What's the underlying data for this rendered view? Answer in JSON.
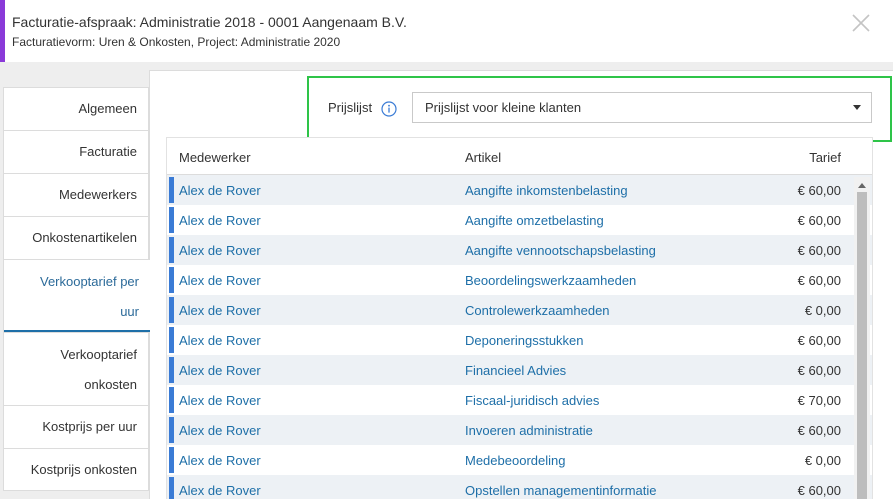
{
  "header": {
    "title": "Facturatie-afspraak: Administratie 2018 - 0001 Aangenaam B.V.",
    "subtitle": "Facturatievorm: Uren & Onkosten, Project: Administratie 2020",
    "accent_color": "#8a3ad8"
  },
  "tabs": [
    {
      "label": "Algemeen",
      "active": false
    },
    {
      "label": "Facturatie",
      "active": false
    },
    {
      "label": "Medewerkers",
      "active": false
    },
    {
      "label": "Onkostenartikelen",
      "active": false
    },
    {
      "label_lines": [
        "Verkooptarief per",
        "uur"
      ],
      "active": true
    },
    {
      "label_lines": [
        "Verkooptarief",
        "onkosten"
      ],
      "active": false
    },
    {
      "label": "Kostprijs per uur",
      "active": false
    },
    {
      "label": "Kostprijs onkosten",
      "active": false
    }
  ],
  "pricelist": {
    "label": "Prijslijst",
    "selected": "Prijslijst voor kleine klanten",
    "highlight_color": "#2ec448"
  },
  "table": {
    "columns": [
      "Medewerker",
      "Artikel",
      "Tarief"
    ],
    "rows": [
      {
        "employee": "Alex de Rover",
        "article": "Aangifte inkomstenbelasting",
        "rate": "€ 60,00"
      },
      {
        "employee": "Alex de Rover",
        "article": "Aangifte omzetbelasting",
        "rate": "€ 60,00"
      },
      {
        "employee": "Alex de Rover",
        "article": "Aangifte vennootschapsbelasting",
        "rate": "€ 60,00"
      },
      {
        "employee": "Alex de Rover",
        "article": "Beoordelingswerkzaamheden",
        "rate": "€ 60,00"
      },
      {
        "employee": "Alex de Rover",
        "article": "Controlewerkzaamheden",
        "rate": "€ 0,00"
      },
      {
        "employee": "Alex de Rover",
        "article": "Deponeringsstukken",
        "rate": "€ 60,00"
      },
      {
        "employee": "Alex de Rover",
        "article": "Financieel Advies",
        "rate": "€ 60,00"
      },
      {
        "employee": "Alex de Rover",
        "article": "Fiscaal-juridisch advies",
        "rate": "€ 70,00"
      },
      {
        "employee": "Alex de Rover",
        "article": "Invoeren administratie",
        "rate": "€ 60,00"
      },
      {
        "employee": "Alex de Rover",
        "article": "Medebeoordeling",
        "rate": "€ 0,00"
      },
      {
        "employee": "Alex de Rover",
        "article": "Opstellen managementinformatie",
        "rate": "€ 60,00"
      }
    ]
  },
  "colors": {
    "link": "#1e6fa8",
    "row_marker": "#3a7bd5",
    "row_stripe": "#edf1f5"
  }
}
